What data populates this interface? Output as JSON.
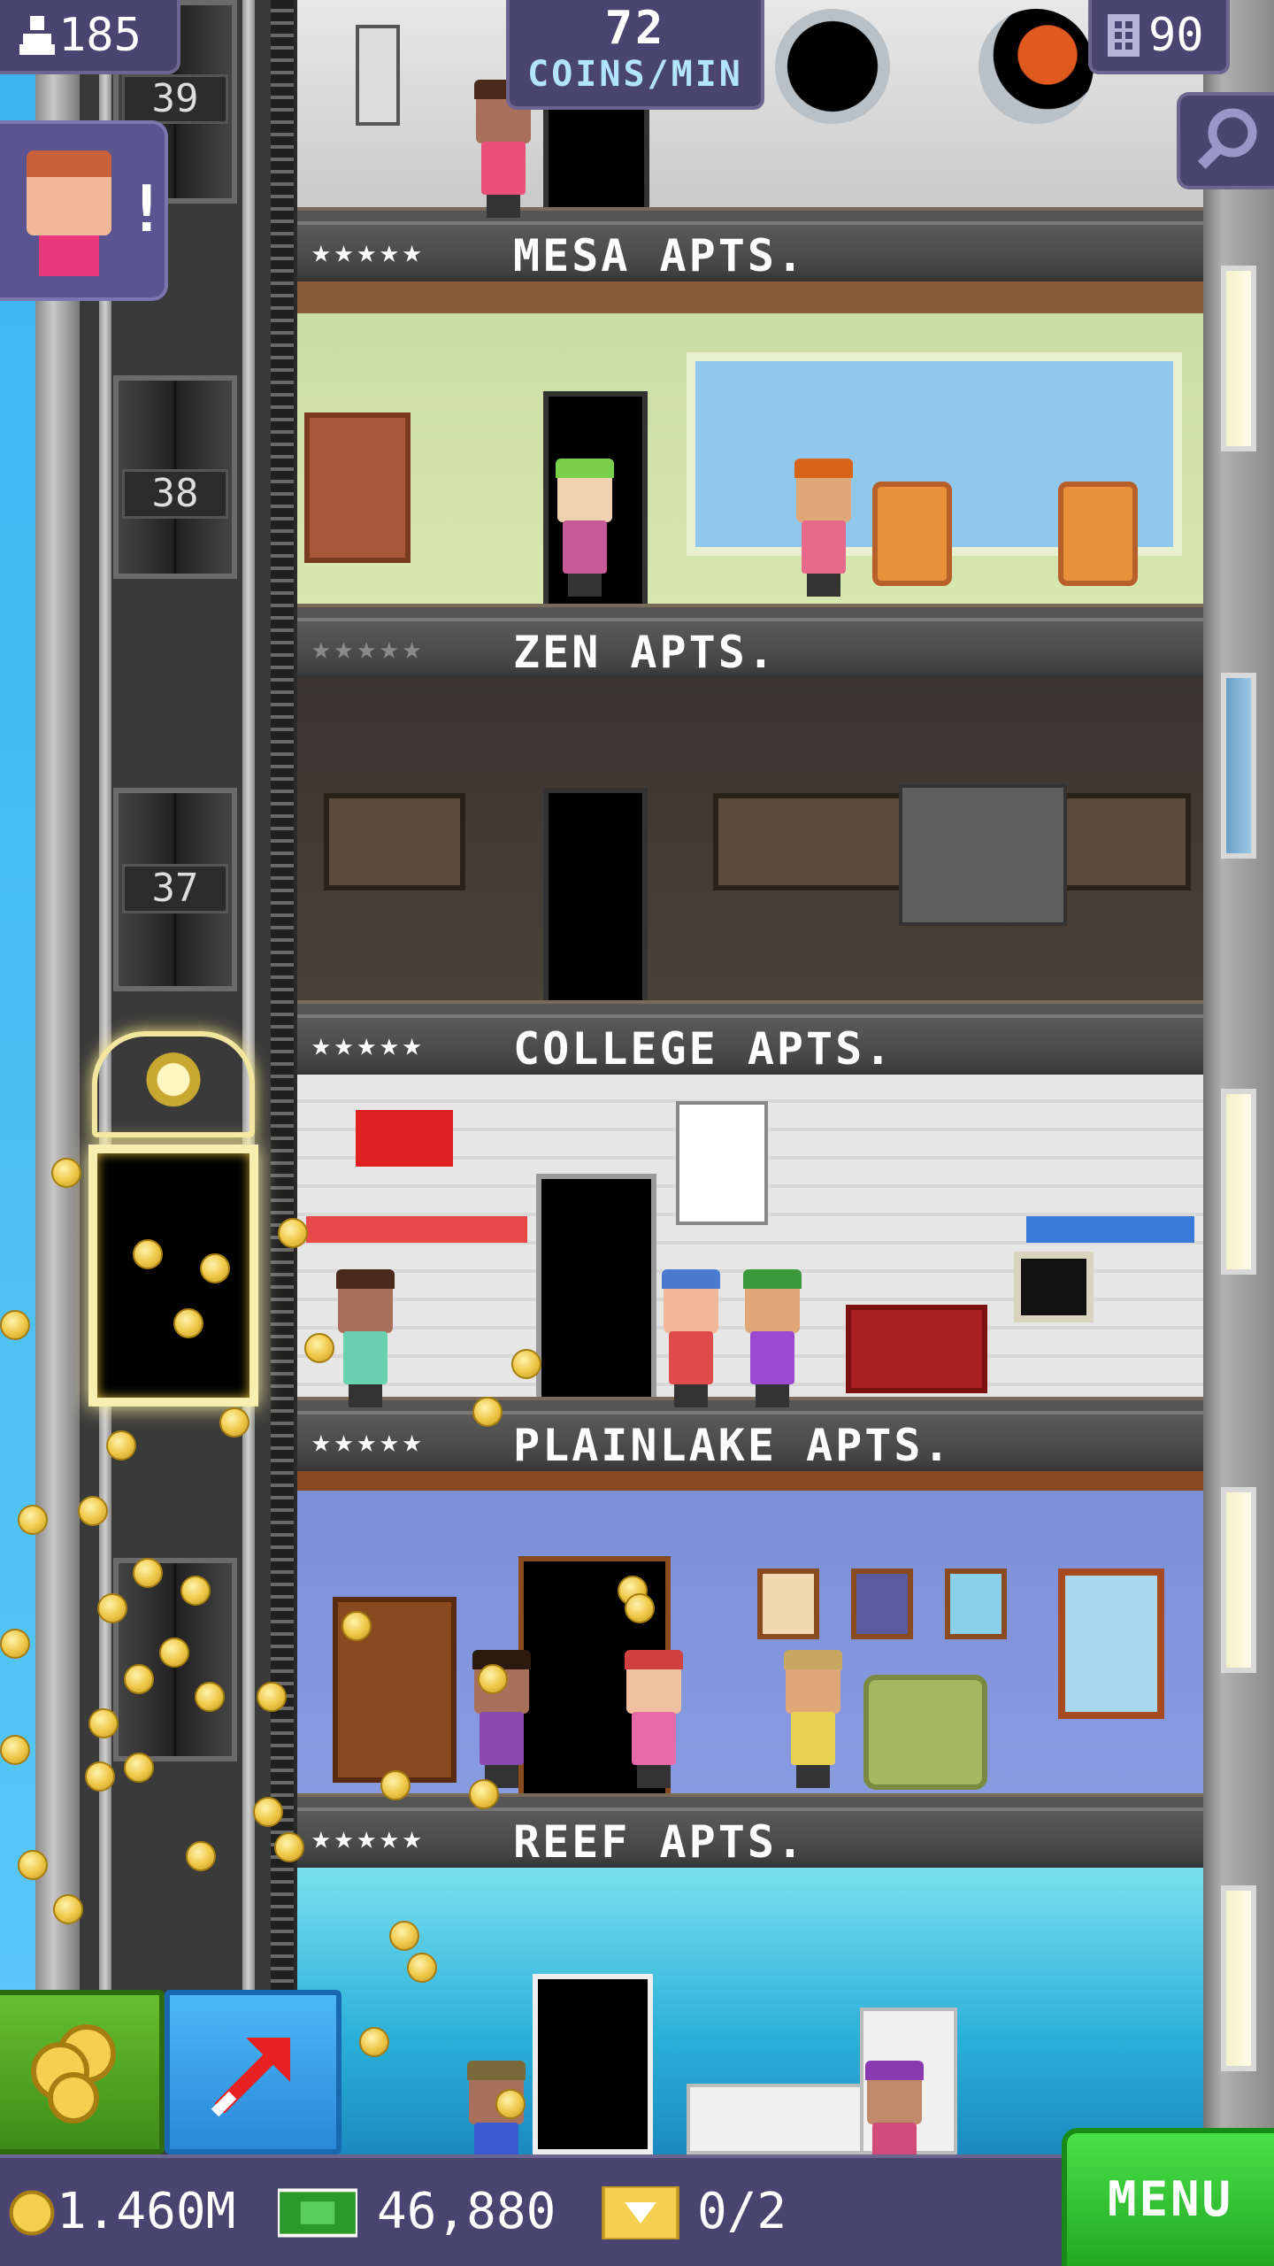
{
  "hud": {
    "population": "185",
    "coins_per_min_value": "72",
    "coins_per_min_unit": "COINS/MIN",
    "floors_count": "90"
  },
  "shaft": {
    "floor_numbers": [
      "39",
      "38",
      "37"
    ]
  },
  "floors": [
    {
      "name": "MESA APTS.",
      "stars": "★★★★★",
      "stars_filled": 5
    },
    {
      "name": "ZEN APTS.",
      "stars": "★★★★★",
      "stars_filled": 0
    },
    {
      "name": "COLLEGE APTS.",
      "stars": "★★★★★",
      "stars_filled": 5
    },
    {
      "name": "PLAINLAKE APTS.",
      "stars": "★★★★★",
      "stars_filled": 5
    },
    {
      "name": "REEF APTS.",
      "stars": "★★★★★",
      "stars_filled": 5
    }
  ],
  "bottom_bar": {
    "coins": "1.460M",
    "bux": "46,880",
    "tickets": "0/2",
    "menu_label": "MENU"
  },
  "colors": {
    "hud_bg": "#4a4570",
    "menu_green": "#22a822",
    "coin_gold": "#f0c94a",
    "sky": "#38b6f0"
  },
  "icons": {
    "population": "person-icon",
    "floors": "building-icon",
    "search": "magnifier-icon",
    "coins": "coin-icon",
    "bux": "banknote-icon",
    "tickets": "ticket-icon",
    "coin_button": "coin-pile-icon",
    "lift_button": "arrow-up-right-icon"
  }
}
